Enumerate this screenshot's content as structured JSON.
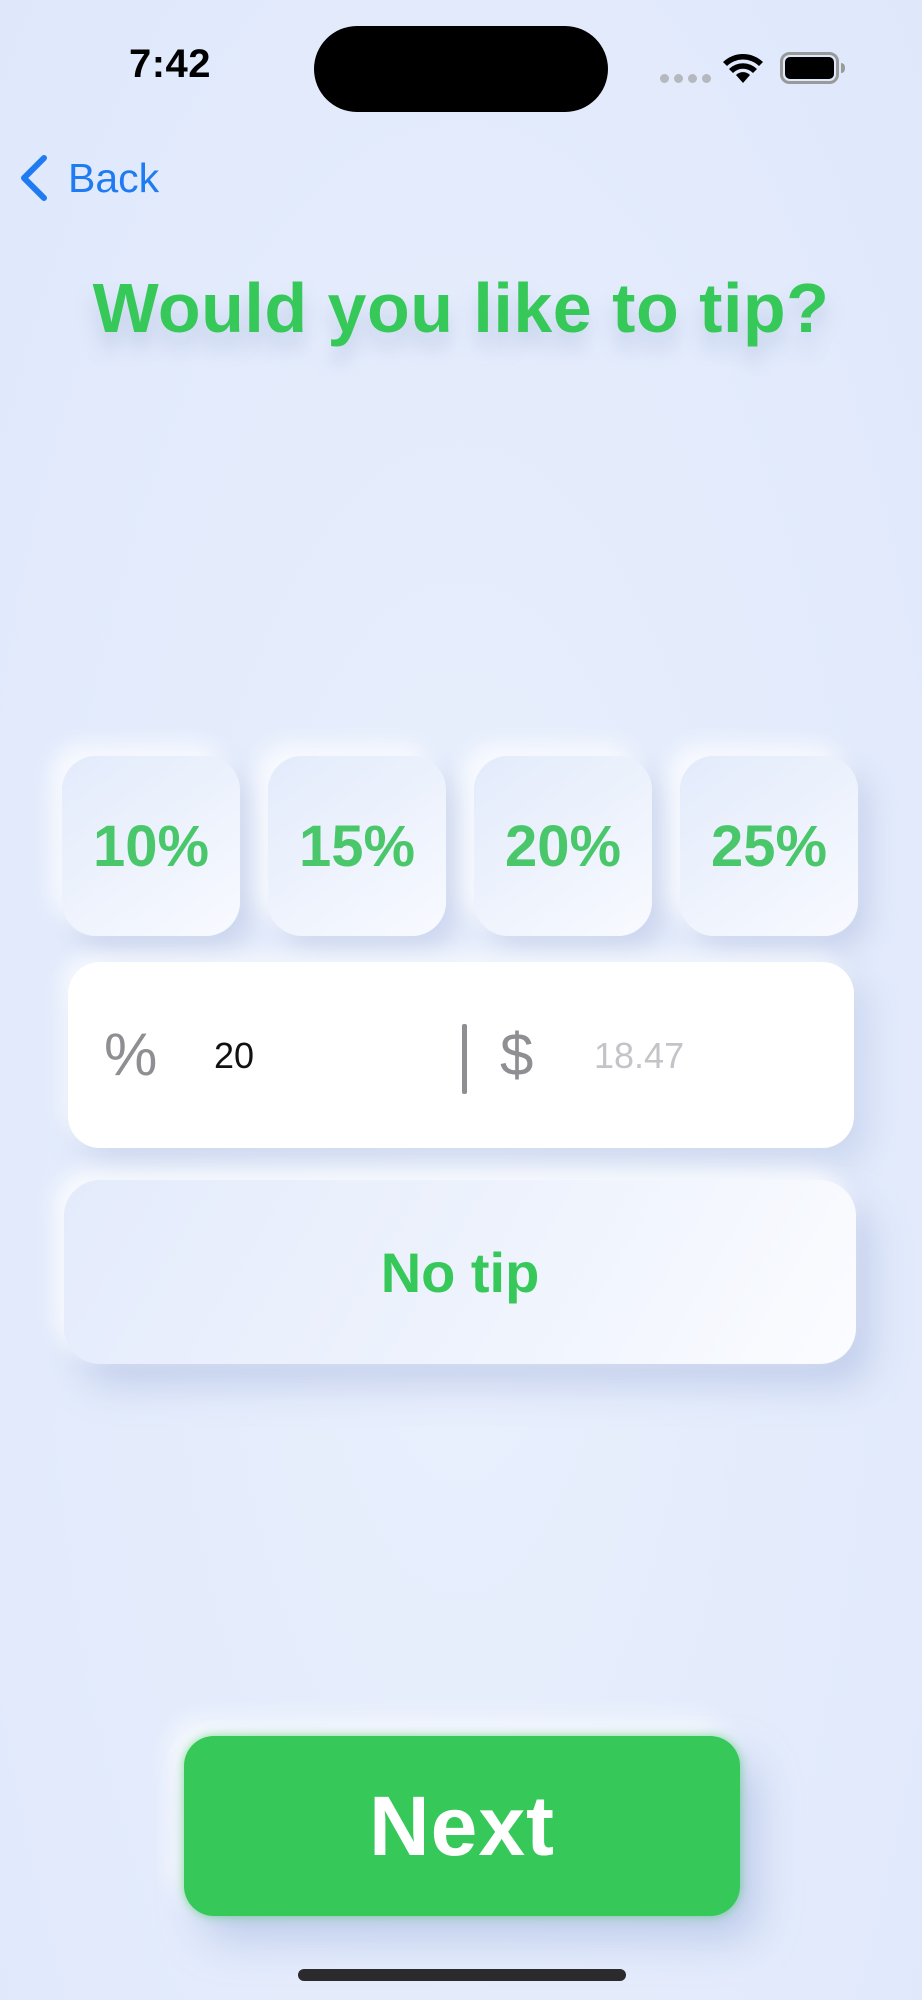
{
  "status_bar": {
    "time": "7:42",
    "wifi_icon": "wifi-icon",
    "battery_icon": "battery-full-icon"
  },
  "nav": {
    "back_label": "Back",
    "back_icon": "chevron-left-icon"
  },
  "title": "Would you like to tip?",
  "presets": [
    {
      "label": "10%"
    },
    {
      "label": "15%"
    },
    {
      "label": "20%"
    },
    {
      "label": "25%"
    }
  ],
  "tip_input": {
    "percent_symbol": "%",
    "percent_value": "20",
    "dollar_symbol": "$",
    "dollar_value": "",
    "dollar_placeholder": "18.47"
  },
  "no_tip_label": "No tip",
  "next_label": "Next",
  "colors": {
    "accent_green": "#37c85a",
    "link_blue": "#1f7bf2",
    "background": "#e4ecfc"
  }
}
